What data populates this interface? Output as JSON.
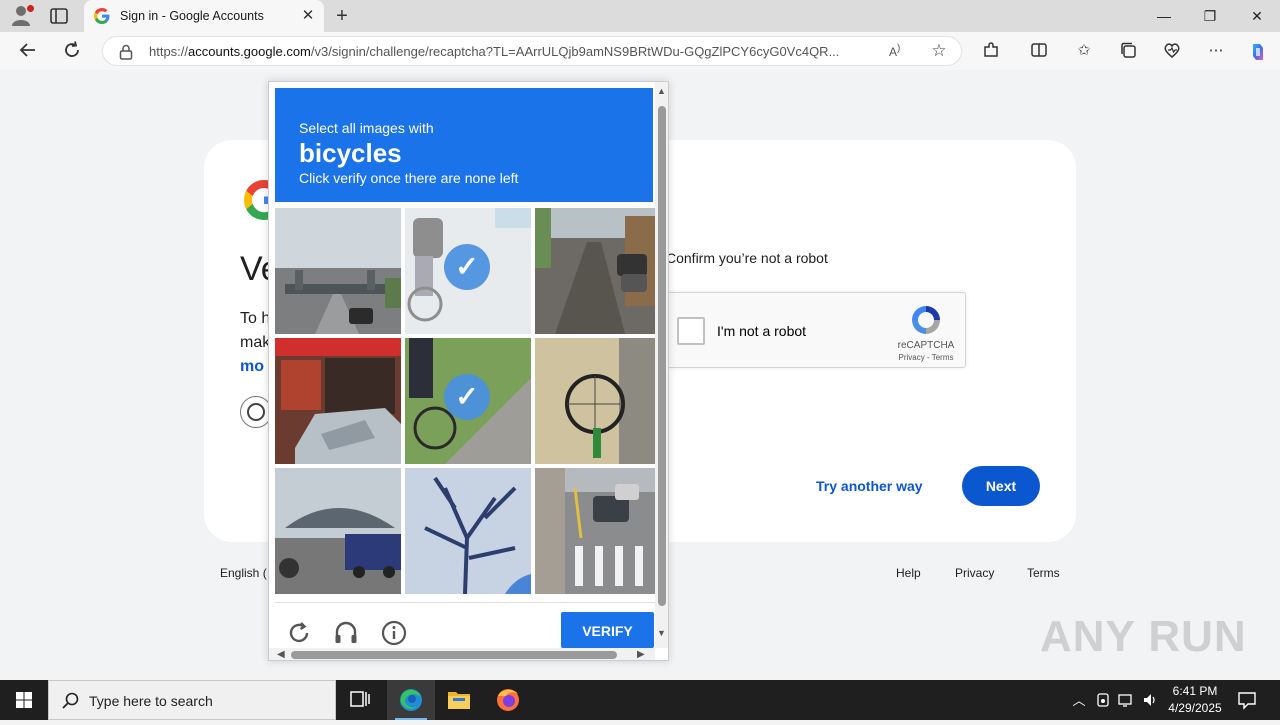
{
  "browser": {
    "tab_title": "Sign in - Google Accounts",
    "url_prefix": "https://",
    "url_host": "accounts.google.com",
    "url_path": "/v3/signin/challenge/recaptcha?TL=AArrULQjb9amNS9BRtWDu-GQgZlPCY6cyG0Vc4QR...",
    "icons": [
      "profile-icon",
      "tab-actions-icon",
      "google-favicon",
      "close-tab-icon",
      "new-tab-icon",
      "minimize-icon",
      "maximize-icon",
      "close-window-icon",
      "back-icon",
      "refresh-icon",
      "lock-icon",
      "read-aloud-icon",
      "favorite-star-icon",
      "extensions-icon",
      "split-screen-icon",
      "favorites-icon",
      "collections-icon",
      "browser-essentials-icon",
      "more-icon",
      "copilot-icon"
    ]
  },
  "signin": {
    "heading_fragment": "Ve",
    "body_line1": "To h",
    "body_line2": "mak",
    "body_line3": "mo",
    "confirm_text": "Confirm you’re not a robot",
    "checkbox_label": "I'm not a robot",
    "recaptcha_name": "reCAPTCHA",
    "recaptcha_terms": "Privacy - Terms",
    "try_another": "Try another way",
    "next": "Next"
  },
  "footer": {
    "language": "English (",
    "help": "Help",
    "privacy": "Privacy",
    "terms": "Terms"
  },
  "captcha": {
    "line1": "Select all images with",
    "target": "bicycles",
    "line3": "Click verify once there are none left",
    "verify": "VERIFY",
    "tiles": [
      {
        "scene": "highway-overpass",
        "selected": false
      },
      {
        "scene": "cyclist-backpack",
        "selected": true
      },
      {
        "scene": "street-parked-cars",
        "selected": false
      },
      {
        "scene": "storefront-car",
        "selected": false
      },
      {
        "scene": "bicycle-grass",
        "selected": true
      },
      {
        "scene": "bicycle-wheel-sand",
        "selected": false
      },
      {
        "scene": "bus-station",
        "selected": false
      },
      {
        "scene": "tree-shadow-snow",
        "selected": false
      },
      {
        "scene": "crosswalk-cars",
        "selected": false
      }
    ],
    "icons": [
      "reload-icon",
      "audio-icon",
      "info-icon"
    ]
  },
  "watermark": "ANY RUN",
  "taskbar": {
    "search_placeholder": "Type here to search",
    "time": "6:41 PM",
    "date": "4/29/2025",
    "apps": [
      "task-view-icon",
      "edge-icon",
      "file-explorer-icon",
      "firefox-icon"
    ]
  },
  "colors": {
    "accent": "#0b57d0",
    "captcha_blue": "#1a73e8",
    "check_blue": "#4a90e2"
  }
}
